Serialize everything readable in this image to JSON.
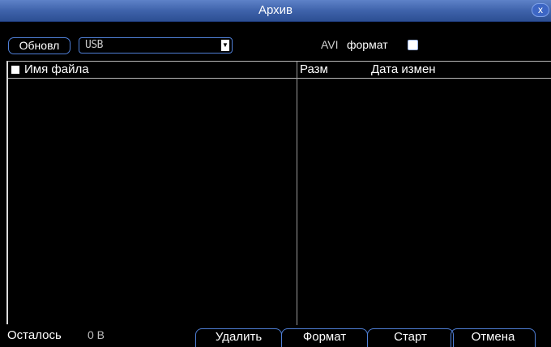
{
  "window": {
    "title": "Архив",
    "close_glyph": "x"
  },
  "toolbar": {
    "refresh_label": "Обновл",
    "device_value": "USB",
    "avi_label": "AVI",
    "format_label": "формат",
    "avi_checked": false
  },
  "table": {
    "headers": {
      "name": "Имя файла",
      "size": "Разм",
      "date": "Дата измен"
    },
    "rows": []
  },
  "footer": {
    "remain_label": "Осталось",
    "remain_value": "0 B",
    "delete_label": "Удалить",
    "format_label": "Формат",
    "start_label": "Старт",
    "cancel_label": "Отмена"
  },
  "colors": {
    "accent": "#4f7fd7",
    "titlebar": "#3f63ab",
    "background": "#000000"
  }
}
